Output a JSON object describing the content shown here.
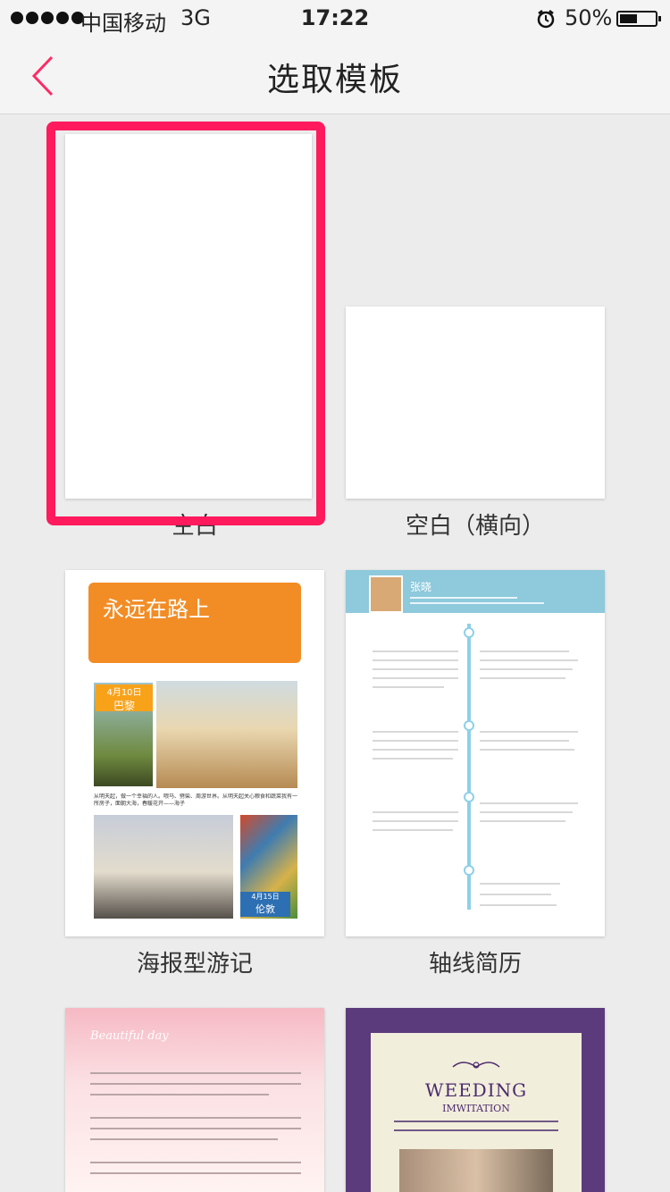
{
  "status_bar": {
    "carrier": "中国移动",
    "network": "3G",
    "time": "17:22",
    "battery": "50%",
    "battery_level": 0.5
  },
  "nav": {
    "title": "选取模板",
    "back_icon": "chevron-left-icon"
  },
  "accent_color": "#ff1a5e",
  "templates": [
    {
      "label": "空白",
      "selected": true
    },
    {
      "label": "空白（横向）",
      "selected": false
    },
    {
      "label": "海报型游记",
      "selected": false,
      "title": "永远在路上",
      "tag1_date": "4月10日",
      "tag1_place": "巴黎",
      "tag2_date": "4月15日",
      "tag2_place": "伦敦",
      "caption": "从明天起，做一个幸福的人。喂马、劈柴、周游世界。从明天起关心粮食和蔬菜我有一所房子，面朝大海，春暖花开——海子"
    },
    {
      "label": "轴线简历",
      "selected": false,
      "name": "张晓"
    },
    {
      "label": "",
      "selected": false,
      "title": "Beautiful day"
    },
    {
      "label": "",
      "selected": false,
      "title": "WEEDING",
      "subtitle": "IMWITATION"
    }
  ]
}
